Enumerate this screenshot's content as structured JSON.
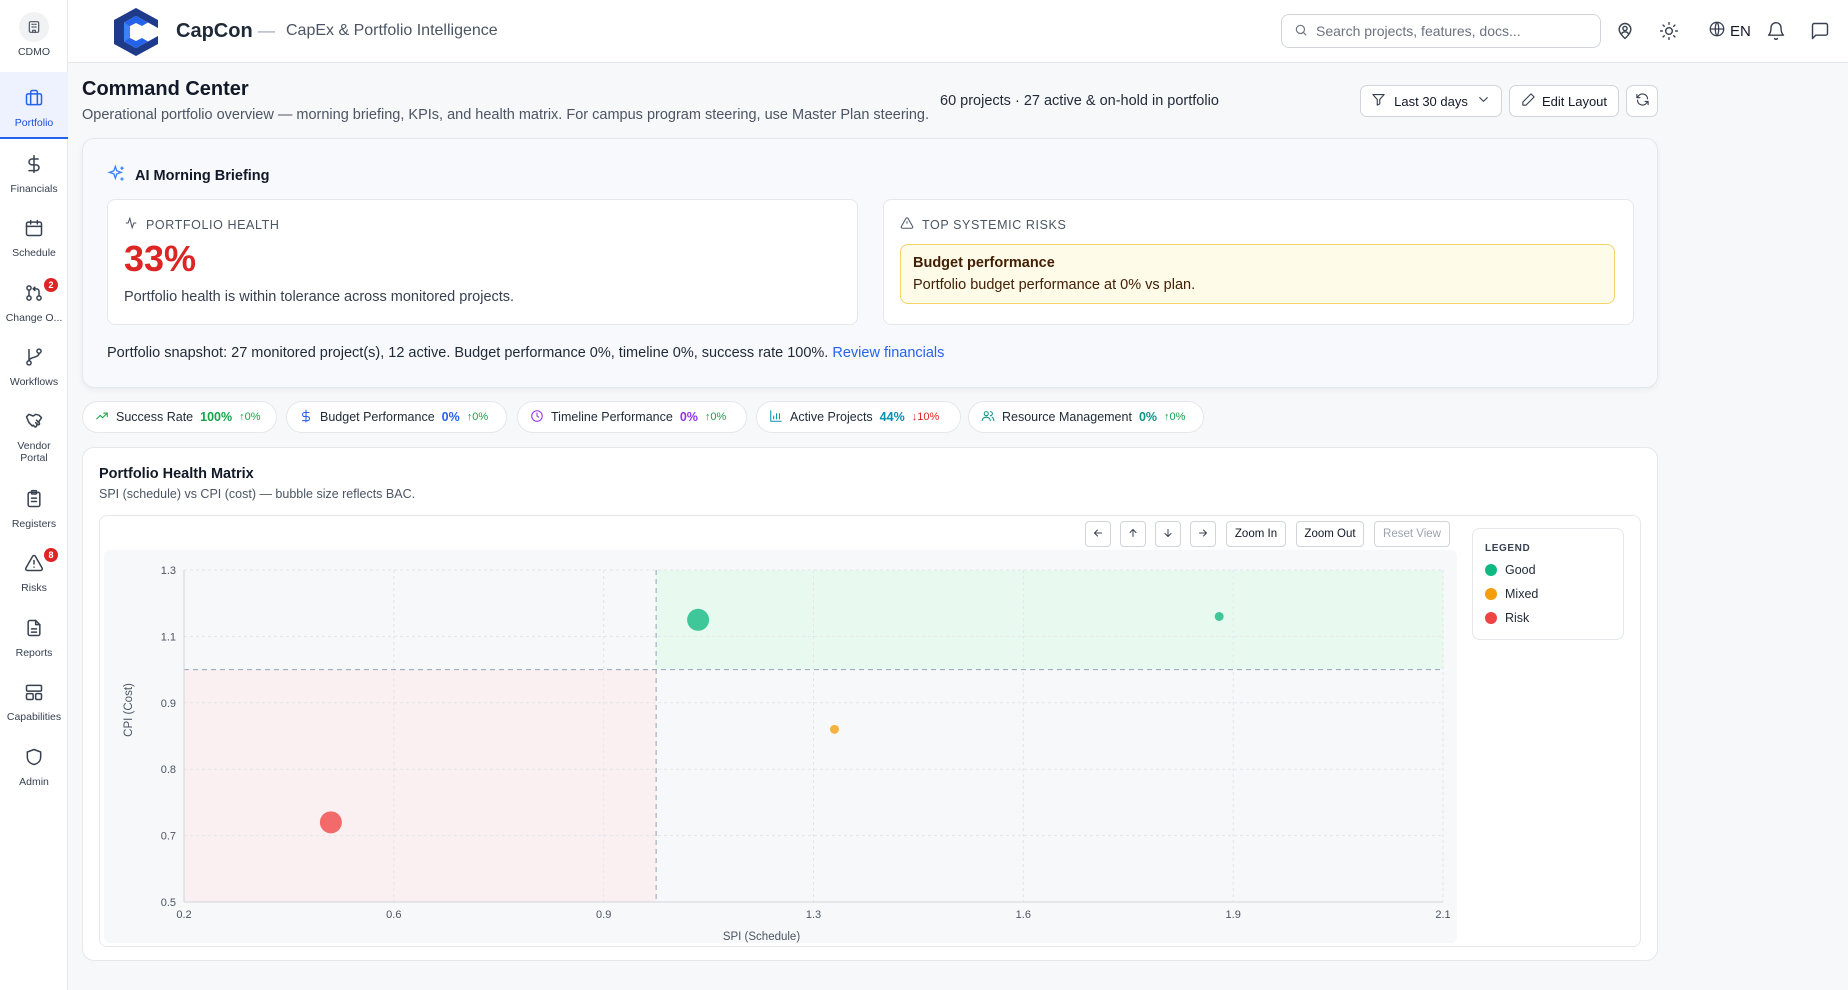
{
  "sidebar": {
    "org": "CDMO",
    "items": [
      {
        "label": "Portfolio",
        "active": true
      },
      {
        "label": "Financials"
      },
      {
        "label": "Schedule"
      },
      {
        "label": "Change O...",
        "badge": "2"
      },
      {
        "label": "Workflows"
      },
      {
        "label": "Vendor Portal"
      },
      {
        "label": "Registers"
      },
      {
        "label": "Risks",
        "badge": "8"
      },
      {
        "label": "Reports"
      },
      {
        "label": "Capabilities"
      },
      {
        "label": "Admin"
      }
    ]
  },
  "header": {
    "brand": "CapCon",
    "separator": "—",
    "subtitle": "CapEx & Portfolio Intelligence",
    "search_placeholder": "Search projects, features, docs...",
    "language": "EN"
  },
  "page": {
    "title": "Command Center",
    "description": "Operational portfolio overview — morning briefing, KPIs, and health matrix. For campus program steering, use Master Plan steering.",
    "project_count": "60 projects · 27 active & on-hold in portfolio",
    "date_filter": "Last 30 days",
    "edit_layout": "Edit Layout"
  },
  "briefing": {
    "title": "AI Morning Briefing",
    "health": {
      "heading": "Portfolio Health",
      "value": "33%",
      "text": "Portfolio health is within tolerance across monitored projects."
    },
    "risks": {
      "heading": "Top Systemic Risks",
      "items": [
        {
          "title": "Budget performance",
          "text": "Portfolio budget performance at 0% vs plan."
        }
      ]
    },
    "snapshot": "Portfolio snapshot: 27 monitored project(s), 12 active. Budget performance 0%, timeline 0%, success rate 100%.",
    "snapshot_link": "Review financials"
  },
  "kpis": [
    {
      "name": "Success Rate",
      "value": "100%",
      "delta": "↑0%",
      "color": "#16a34a",
      "delta_color": "#16a34a",
      "icon": "trending-up-icon"
    },
    {
      "name": "Budget Performance",
      "value": "0%",
      "delta": "↑0%",
      "color": "#2563eb",
      "delta_color": "#16a34a",
      "icon": "dollar-icon"
    },
    {
      "name": "Timeline Performance",
      "value": "0%",
      "delta": "↑0%",
      "color": "#9333ea",
      "delta_color": "#16a34a",
      "icon": "clock-icon"
    },
    {
      "name": "Active Projects",
      "value": "44%",
      "delta": "↓10%",
      "color": "#0891b2",
      "delta_color": "#dc2626",
      "icon": "bar-chart-icon"
    },
    {
      "name": "Resource Management",
      "value": "0%",
      "delta": "↑0%",
      "color": "#0d9488",
      "delta_color": "#16a34a",
      "icon": "users-icon"
    }
  ],
  "matrix": {
    "title": "Portfolio Health Matrix",
    "subtitle": "SPI (schedule) vs CPI (cost) — bubble size reflects BAC.",
    "controls": {
      "zoom_in": "Zoom In",
      "zoom_out": "Zoom Out",
      "reset": "Reset View"
    },
    "legend": {
      "title": "LEGEND",
      "items": [
        {
          "label": "Good",
          "color": "#10b981"
        },
        {
          "label": "Mixed",
          "color": "#f59e0b"
        },
        {
          "label": "Risk",
          "color": "#ef4444"
        }
      ]
    }
  },
  "chart_data": {
    "type": "scatter",
    "xlabel": "SPI (Schedule)",
    "ylabel": "CPI (Cost)",
    "xlim": [
      0.2,
      2.1
    ],
    "x_ticks": [
      "0.2",
      "0.6",
      "0.9",
      "1.3",
      "1.6",
      "1.9",
      "2.1"
    ],
    "y_ticks": [
      "1.3",
      "1.1",
      "0.9",
      "0.8",
      "0.7",
      "0.5"
    ],
    "threshold_spi": 1.0,
    "threshold_cpi": 1.0,
    "points": [
      {
        "spi": 1.08,
        "cpi": 1.15,
        "status": "Good",
        "size": "large"
      },
      {
        "spi": 1.88,
        "cpi": 1.16,
        "status": "Good",
        "size": "small"
      },
      {
        "spi": 1.33,
        "cpi": 0.86,
        "status": "Mixed",
        "size": "small"
      },
      {
        "spi": 0.48,
        "cpi": 0.72,
        "status": "Risk",
        "size": "large"
      }
    ]
  }
}
